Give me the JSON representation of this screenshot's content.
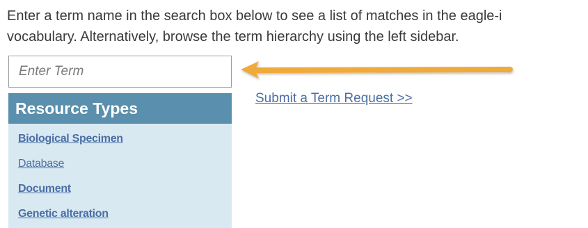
{
  "intro": {
    "line1": "Enter a term name in the search box below to see a list of matches in the eagle-i",
    "line2": "vocabulary. Alternatively, browse the term hierarchy using the left sidebar."
  },
  "search": {
    "placeholder": "Enter Term",
    "value": ""
  },
  "submit_link": "Submit a Term Request >>",
  "sidebar": {
    "title": "Resource Types",
    "items": [
      {
        "label": "Biological Specimen"
      },
      {
        "label": "Database"
      },
      {
        "label": "Document"
      },
      {
        "label": "Genetic alteration"
      }
    ]
  },
  "colors": {
    "sidebar_header": "#5a90ad",
    "sidebar_bg": "#d9e9f2",
    "link": "#4a6fa5",
    "arrow": "#f0a93a"
  },
  "icons": {
    "arrow": "left-arrow-icon"
  }
}
